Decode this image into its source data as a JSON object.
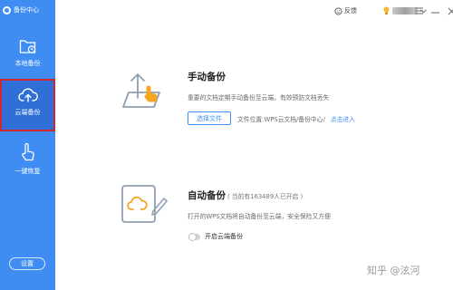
{
  "app": {
    "title": "备份中心"
  },
  "sidebar": {
    "items": [
      {
        "label": "本地备份",
        "icon": "folder-clock-icon",
        "active": false
      },
      {
        "label": "云端备份",
        "icon": "cloud-upload-icon",
        "active": true
      },
      {
        "label": "一键恢复",
        "icon": "hand-pointer-icon",
        "active": false
      }
    ],
    "settings_label": "设置"
  },
  "titlebar": {
    "feedback_label": "反馈"
  },
  "manual": {
    "title": "手动备份",
    "description": "重要的文档定期手动备份至云端，有效预防文档丢失",
    "select_button": "选择文件",
    "location_text": "文件位置:WPS云文档/备份中心/",
    "location_link": "点击进入"
  },
  "auto": {
    "title": "自动备份",
    "subtitle": "( 当前有163489人已开启 )",
    "description": "打开的WPS文档将自动备份至云端，安全保险又方便",
    "toggle_label": "开启云端备份",
    "toggle_on": false
  },
  "watermark": "知乎 @泫河",
  "colors": {
    "accent": "#3f8df2",
    "sidebar_active": "#2f6fd6",
    "highlight_border": "#d2262f",
    "icon_orange": "#f6a623"
  }
}
